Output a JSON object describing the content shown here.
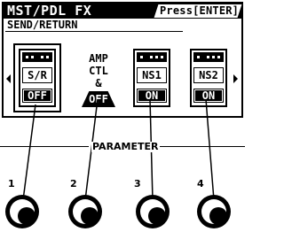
{
  "screen": {
    "title": "MST/PDL FX",
    "hint": "Press[ENTER]",
    "subtitle": "SEND/RETURN",
    "nav": {
      "left_icon": "triangle-left-icon",
      "right_icon": "triangle-right-icon"
    },
    "pedals": [
      {
        "name": "S/R",
        "state": "OFF",
        "selected": true
      },
      {
        "name": "NS1",
        "state": "ON",
        "selected": false
      },
      {
        "name": "NS2",
        "state": "ON",
        "selected": false
      }
    ],
    "amp_ctl": {
      "line1": "AMP",
      "line2": "CTL",
      "line3": "&",
      "state": "OFF"
    }
  },
  "parameter": {
    "label": "PARAMETER",
    "knobs": [
      {
        "number": "1"
      },
      {
        "number": "2"
      },
      {
        "number": "3"
      },
      {
        "number": "4"
      }
    ]
  },
  "colors": {
    "foreground": "#000000",
    "background": "#ffffff"
  }
}
